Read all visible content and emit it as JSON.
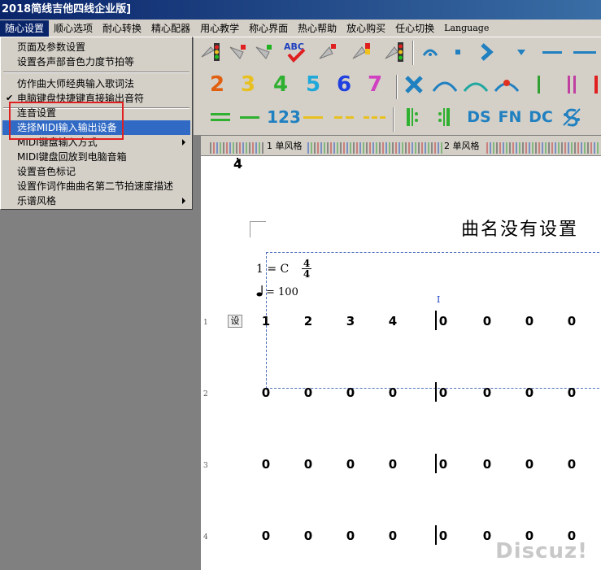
{
  "window": {
    "title": "2018简线吉他四线企业版]"
  },
  "menubar": {
    "items": [
      "随心设置",
      "顺心选项",
      "耐心转换",
      "精心配器",
      "用心教学",
      "称心界面",
      "热心帮助",
      "放心购买",
      "任心切换",
      "Language"
    ],
    "active_index": 0
  },
  "dropdown": {
    "items": [
      {
        "label": "页面及参数设置",
        "checked": false,
        "submenu": false
      },
      {
        "label": "设置各声部音色力度节拍等",
        "checked": false,
        "submenu": false
      },
      {
        "label": "仿作曲大师经典输入歌词法",
        "checked": false,
        "submenu": false
      },
      {
        "label": "电脑键盘快捷键直接输出音符",
        "checked": true,
        "submenu": false
      },
      {
        "label": "连音设置",
        "checked": false,
        "submenu": false
      },
      {
        "label": "选择MIDI输入输出设备",
        "checked": false,
        "submenu": false,
        "highlighted": true
      },
      {
        "label": "MIDI键盘输入方式",
        "checked": false,
        "submenu": true
      },
      {
        "label": "MIDI键盘回放到电脑音箱",
        "checked": false,
        "submenu": false
      },
      {
        "label": "设置音色标记",
        "checked": false,
        "submenu": false
      },
      {
        "label": "设置作词作曲曲名第二节拍速度描述",
        "checked": false,
        "submenu": false
      },
      {
        "label": "乐谱风格",
        "checked": false,
        "submenu": true
      }
    ],
    "check_glyph": "✔"
  },
  "toolbar": {
    "row2_numbers": [
      "2",
      "3",
      "4",
      "5",
      "6",
      "7"
    ],
    "row2_colors": [
      "#e06010",
      "#e8c020",
      "#30b030",
      "#20a8d8",
      "#2040e0",
      "#d040c0"
    ],
    "row3_labels": {
      "num123": "123",
      "ds": "DS",
      "fn": "FN",
      "dc": "DC"
    },
    "abc_label": "ABC"
  },
  "ruler": {
    "labels": [
      "1 单风格",
      "2 单风格"
    ]
  },
  "score": {
    "title": "曲名没有设置",
    "key": "1 = C",
    "time_sig_top": "4",
    "time_sig_bottom": "4",
    "tempo": "= 100",
    "top_fragment": "4",
    "cursor_mark": "I",
    "set_button": "设",
    "rows": [
      {
        "line_no": "1",
        "notes": [
          "1",
          "2",
          "3",
          "4",
          "0",
          "0",
          "0",
          "0"
        ]
      },
      {
        "line_no": "2",
        "notes": [
          "0",
          "0",
          "0",
          "0",
          "0",
          "0",
          "0",
          "0"
        ]
      },
      {
        "line_no": "3",
        "notes": [
          "0",
          "0",
          "0",
          "0",
          "0",
          "0",
          "0",
          "0"
        ]
      },
      {
        "line_no": "4",
        "notes": [
          "0",
          "0",
          "0",
          "0",
          "0",
          "0",
          "0",
          "0"
        ]
      }
    ]
  },
  "watermark": "Discuz!"
}
